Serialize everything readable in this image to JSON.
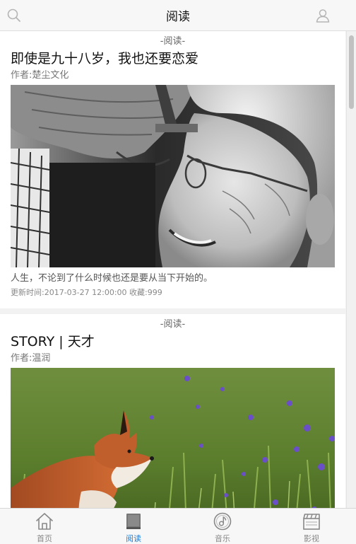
{
  "header": {
    "title": "阅读"
  },
  "articles": [
    {
      "section": "-阅读-",
      "title": "即使是九十八岁，我也还要恋爱",
      "author": "作者:楚尘文化",
      "description": "人生，不论到了什么时候也还是要从当下开始的。",
      "meta": "更新时间:2017-03-27 12:00:00 收藏:999"
    },
    {
      "section": "-阅读-",
      "title": "STORY | 天才",
      "author": "作者:温润"
    }
  ],
  "tabs": [
    {
      "label": "首页",
      "icon": "home-icon",
      "active": false
    },
    {
      "label": "阅读",
      "icon": "book-icon",
      "active": true
    },
    {
      "label": "音乐",
      "icon": "music-disc-icon",
      "active": false
    },
    {
      "label": "影视",
      "icon": "clapperboard-icon",
      "active": false
    }
  ],
  "colors": {
    "accent": "#1e7fd6",
    "tab_inactive": "#888888",
    "background": "#f2f2f2"
  }
}
